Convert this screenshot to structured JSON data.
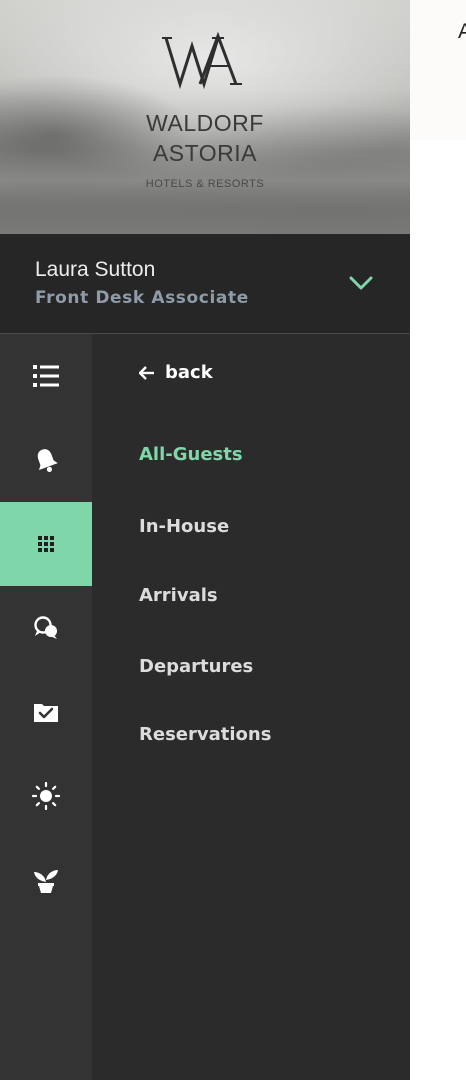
{
  "brand": {
    "line1": "WALDORF",
    "line2": "ASTORIA",
    "line3": "HOTELS & RESORTS"
  },
  "user": {
    "name": "Laura Sutton",
    "role": "Front Desk Associate"
  },
  "rail": [
    {
      "name": "menu-list-icon",
      "active": false
    },
    {
      "name": "bell-icon",
      "active": false
    },
    {
      "name": "grid-icon",
      "active": true
    },
    {
      "name": "chat-bubbles-icon",
      "active": false
    },
    {
      "name": "folder-check-icon",
      "active": false
    },
    {
      "name": "sun-icon",
      "active": false
    },
    {
      "name": "plant-icon",
      "active": false
    }
  ],
  "submenu": {
    "back_label": "back",
    "items": [
      {
        "label": "All-Guests",
        "active": true
      },
      {
        "label": "In-House",
        "active": false
      },
      {
        "label": "Arrivals",
        "active": false
      },
      {
        "label": "Departures",
        "active": false
      },
      {
        "label": "Reservations",
        "active": false
      }
    ]
  },
  "main": {
    "title": "A"
  },
  "colors": {
    "accent": "#7fd6a8",
    "sidebar_bg": "#2b2b2b",
    "rail_bg": "#333333",
    "role_text": "#8e9ba8"
  }
}
